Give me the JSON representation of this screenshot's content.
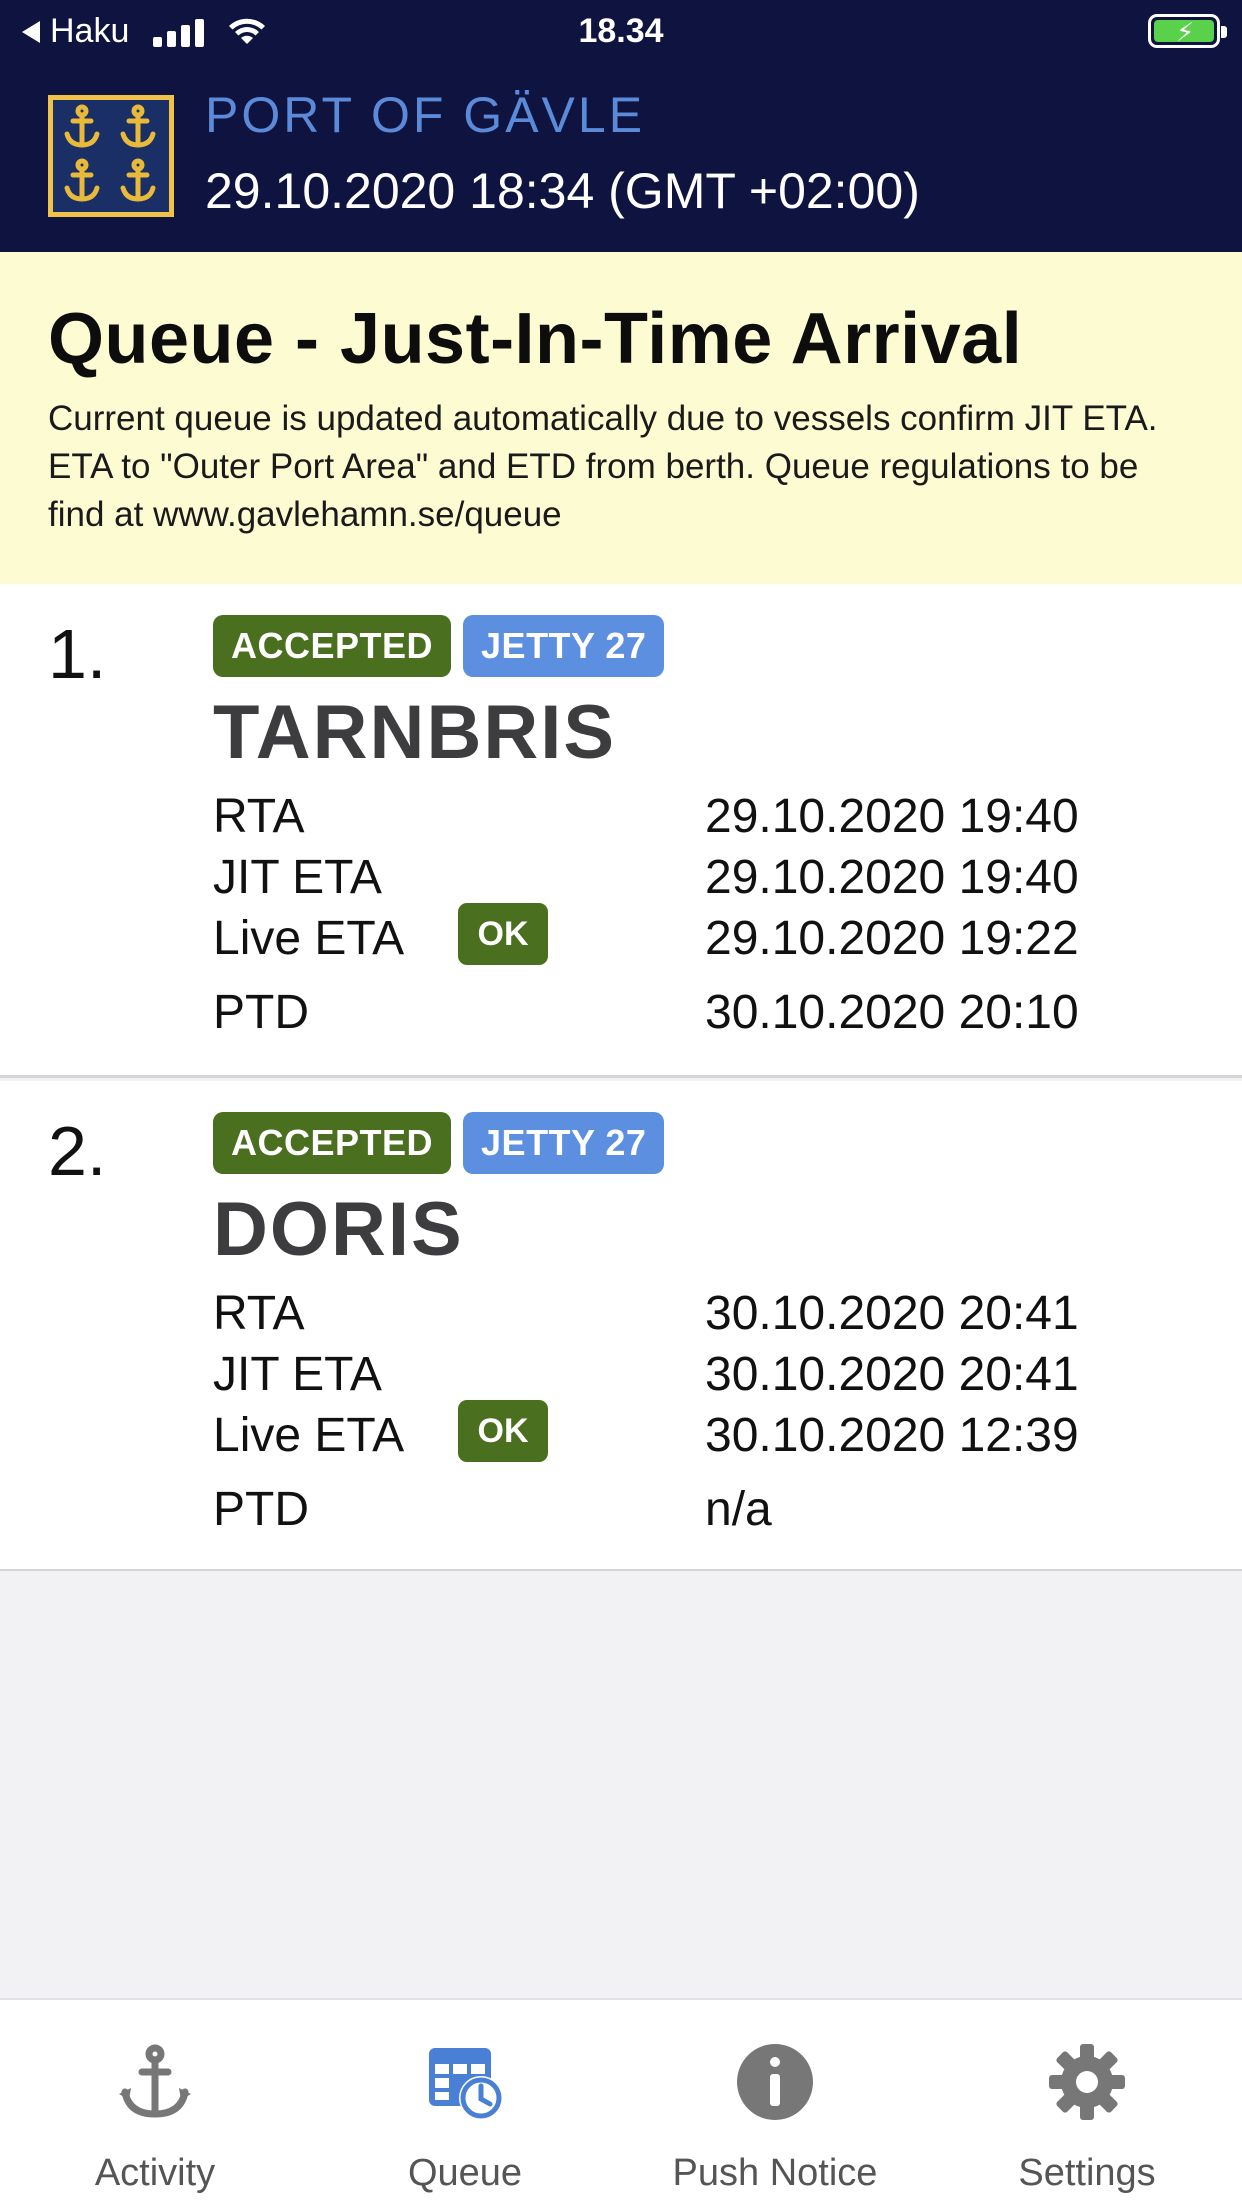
{
  "status_bar": {
    "back_label": "Haku",
    "time": "18.34"
  },
  "header": {
    "brand": "PORT OF GÄVLE",
    "datetime": "29.10.2020 18:34 (GMT +02:00)",
    "background_color": "#0f1340",
    "brand_color": "#5b8ad9"
  },
  "notice": {
    "title": "Queue - Just-In-Time Arrival",
    "text": "Current queue is updated automatically due to vessels confirm JIT ETA.  ETA to \"Outer Port Area\" and ETD from berth.  Queue regulations to be find at www.gavlehamn.se/queue",
    "background_color": "#fdfbd2"
  },
  "queue": [
    {
      "position": "1.",
      "status_badge": "ACCEPTED",
      "berth_badge": "JETTY 27",
      "vessel": "TARNBRIS",
      "rows": [
        {
          "label": "RTA",
          "value": "29.10.2020 19:40"
        },
        {
          "label": "JIT ETA",
          "value": "29.10.2020 19:40"
        },
        {
          "label": "Live ETA",
          "value": "29.10.2020 19:22",
          "badge": "OK"
        },
        {
          "label": "PTD",
          "value": "30.10.2020 20:10"
        }
      ]
    },
    {
      "position": "2.",
      "status_badge": "ACCEPTED",
      "berth_badge": "JETTY 27",
      "vessel": "DORIS",
      "rows": [
        {
          "label": "RTA",
          "value": "30.10.2020 20:41"
        },
        {
          "label": "JIT ETA",
          "value": "30.10.2020 20:41"
        },
        {
          "label": "Live ETA",
          "value": "30.10.2020 12:39",
          "badge": "OK"
        },
        {
          "label": "PTD",
          "value": "n/a"
        }
      ]
    }
  ],
  "colors": {
    "accepted": "#4a6f1e",
    "jetty": "#5c8fe0",
    "active_tab": "#4a7fd6"
  },
  "tabs": [
    {
      "label": "Activity",
      "icon": "anchor-icon"
    },
    {
      "label": "Queue",
      "icon": "queue-calendar-clock-icon",
      "active": true
    },
    {
      "label": "Push Notice",
      "icon": "info-icon"
    },
    {
      "label": "Settings",
      "icon": "gear-icon"
    }
  ]
}
